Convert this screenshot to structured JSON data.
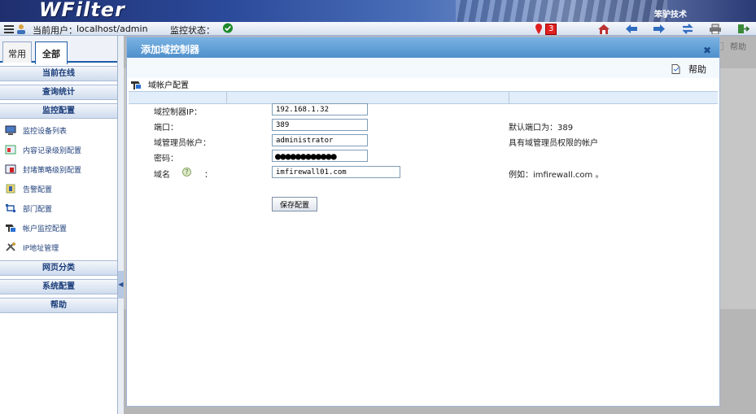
{
  "header": {
    "logo": "WFilter",
    "company": "笨驴技术"
  },
  "status": {
    "user_label": "当前用户：",
    "user_value": "localhost/admin",
    "monitor_label": "监控状态：",
    "alert_count": "3"
  },
  "sidebar": {
    "tabs": [
      {
        "label": "常用"
      },
      {
        "label": "全部"
      }
    ],
    "sections": [
      {
        "label": "当前在线"
      },
      {
        "label": "查询统计"
      },
      {
        "label": "监控配置"
      },
      {
        "label": "网页分类"
      },
      {
        "label": "系统配置"
      },
      {
        "label": "帮助"
      }
    ],
    "items": [
      {
        "label": "监控设备列表"
      },
      {
        "label": "内容记录级别配置"
      },
      {
        "label": "封堵策略级别配置"
      },
      {
        "label": "告警配置"
      },
      {
        "label": "部门配置"
      },
      {
        "label": "帐户监控配置"
      },
      {
        "label": "IP地址管理"
      }
    ]
  },
  "background": {
    "help_label": "帮助"
  },
  "dialog": {
    "title": "添加域控制器",
    "help_label": "帮助",
    "section_title": "域帐户配置",
    "form": {
      "ip": {
        "label": "域控制器IP：",
        "value": "192.168.1.32"
      },
      "port": {
        "label": "端口：",
        "value": "389",
        "hint": "默认端口为：389"
      },
      "admin": {
        "label": "域管理员帐户：",
        "value": "administrator",
        "hint": "具有域管理员权限的帐户"
      },
      "password": {
        "label": "密码：",
        "value": "●●●●●●●●●●●●"
      },
      "domain": {
        "label": "域名",
        "colon": "：",
        "value": "imfirewall01.com",
        "hint": "例如：imfirewall.com 。"
      }
    },
    "save_label": "保存配置"
  },
  "colors": {
    "accent": "#1d5ba6",
    "dialog_header": "#5a9ad3",
    "alert": "#e02020"
  }
}
